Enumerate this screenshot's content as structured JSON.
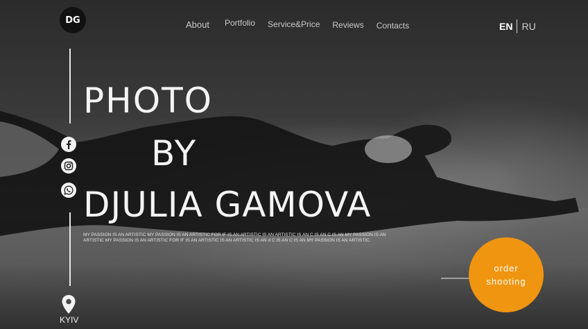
{
  "header": {
    "logo_text": "DG",
    "nav": [
      "About",
      "Portfolio",
      "Service&Price",
      "Reviews",
      "Contacts"
    ],
    "languages": {
      "active": "EN",
      "other": "RU"
    }
  },
  "social": [
    "facebook-icon",
    "instagram-icon",
    "whatsapp-icon"
  ],
  "hero": {
    "line1": "PHOTO",
    "line2": "BY",
    "line3": "DJULIA GAMOVA",
    "tagline": "MY PASSION IS AN ARTISTIC MY PASSION IS AN ARTISTIC FOR IF IS AN ARTISTIC IS AN ARTISTIC IS AN C IS AN C IS AN MY PASSION IS AN ARTISTIC MY PASSION IS AN ARTISTIC FOR IF IS AN ARTISTIC IS AN ARTISTIC IS AN d C IS AN C IS AN MY PASSION IS AN ARTISTIC."
  },
  "cta": {
    "line1": "order",
    "line2": "shooting",
    "color": "#f0950f"
  },
  "location": {
    "city": "KYIV"
  }
}
